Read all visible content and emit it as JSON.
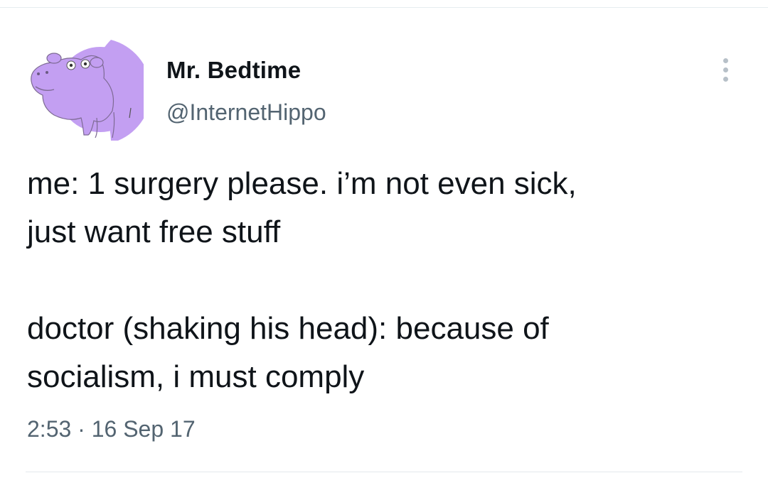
{
  "tweet": {
    "author": {
      "display_name": "Mr. Bedtime",
      "handle": "@InternetHippo",
      "avatar_icon": "purple-hippo-avatar",
      "avatar_color": "#c39ff2"
    },
    "text": "me: 1 surgery please. i’m not even sick,\njust want free stuff\n\ndoctor (shaking his head): because of\nsocialism, i must comply",
    "time": "2:53",
    "separator": "·",
    "date": "16 Sep 17",
    "more_icon": "more-vertical-icon"
  },
  "colors": {
    "text_primary": "#0f1419",
    "text_secondary": "#536471",
    "divider": "#e3e8ec"
  }
}
